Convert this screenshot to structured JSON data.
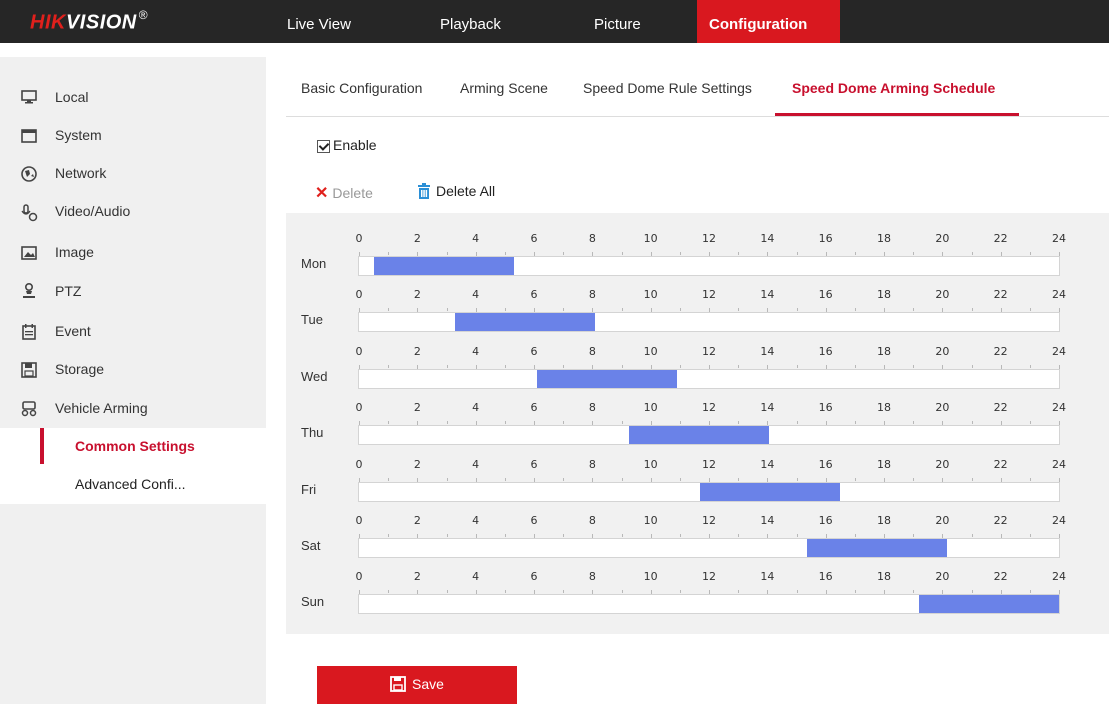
{
  "brand": {
    "logo_hik": "HIK",
    "logo_vision": "VISION",
    "logo_reg": "®"
  },
  "topnav": [
    {
      "label": "Live View",
      "active": false
    },
    {
      "label": "Playback",
      "active": false
    },
    {
      "label": "Picture",
      "active": false
    },
    {
      "label": "Configuration",
      "active": true
    }
  ],
  "sidebar": {
    "items": [
      {
        "label": "Local",
        "icon": "monitor-icon"
      },
      {
        "label": "System",
        "icon": "window-icon"
      },
      {
        "label": "Network",
        "icon": "globe-icon"
      },
      {
        "label": "Video/Audio",
        "icon": "microphone-camera-icon"
      },
      {
        "label": "Image",
        "icon": "picture-icon"
      },
      {
        "label": "PTZ",
        "icon": "person-icon"
      },
      {
        "label": "Event",
        "icon": "calendar-icon"
      },
      {
        "label": "Storage",
        "icon": "floppy-icon"
      },
      {
        "label": "Vehicle Arming",
        "icon": "vehicle-icon"
      }
    ],
    "subitems": [
      {
        "label": "Common Settings",
        "active": true
      },
      {
        "label": "Advanced Confi...",
        "active": false
      }
    ]
  },
  "tabs": [
    {
      "label": "Basic Configuration",
      "active": false
    },
    {
      "label": "Arming Scene",
      "active": false
    },
    {
      "label": "Speed Dome Rule Settings",
      "active": false
    },
    {
      "label": "Speed Dome Arming Schedule",
      "active": true
    }
  ],
  "enable": {
    "label": "Enable",
    "checked": true
  },
  "toolbar": {
    "delete_label": "Delete",
    "delete_all_label": "Delete All"
  },
  "schedule": {
    "tick_labels": [
      "0",
      "2",
      "4",
      "6",
      "8",
      "10",
      "12",
      "14",
      "16",
      "18",
      "20",
      "22",
      "24"
    ],
    "days": [
      {
        "label": "Mon",
        "start": 0.5,
        "end": 5.3
      },
      {
        "label": "Tue",
        "start": 3.3,
        "end": 8.1
      },
      {
        "label": "Wed",
        "start": 6.1,
        "end": 10.9
      },
      {
        "label": "Thu",
        "start": 9.25,
        "end": 14.05
      },
      {
        "label": "Fri",
        "start": 11.7,
        "end": 16.5
      },
      {
        "label": "Sat",
        "start": 15.35,
        "end": 20.15
      },
      {
        "label": "Sun",
        "start": 19.2,
        "end": 24
      }
    ],
    "bar_color": "#6a82e8"
  },
  "save": {
    "label": "Save"
  },
  "colors": {
    "accent": "#d9181f",
    "topbar": "#262626"
  }
}
